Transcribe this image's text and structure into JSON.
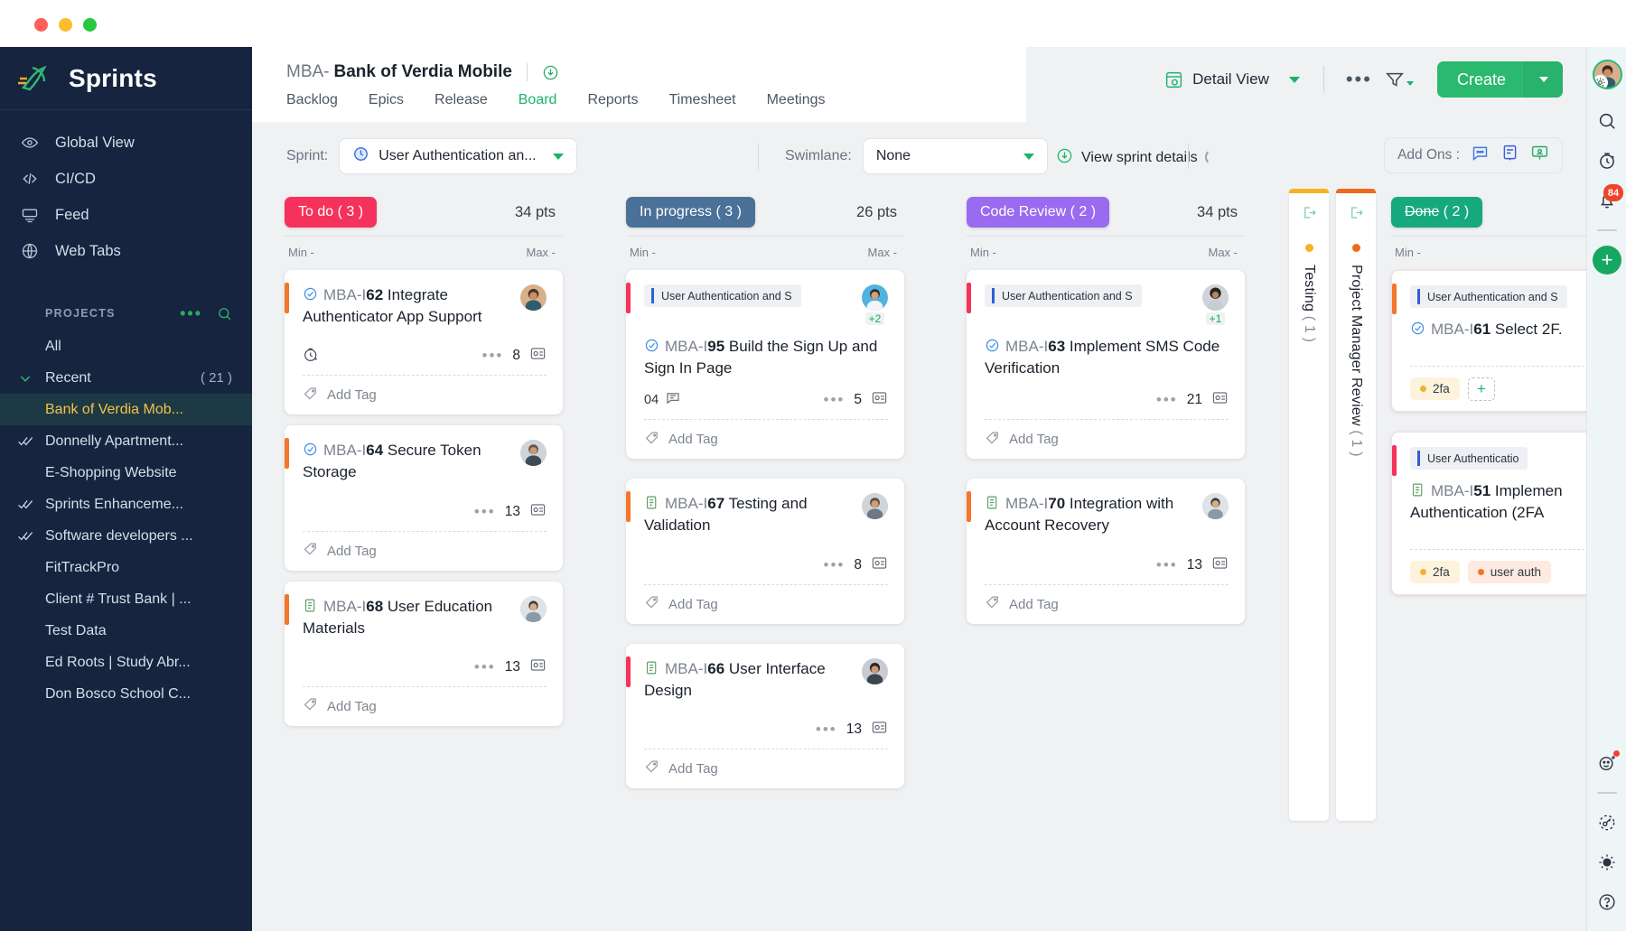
{
  "window": {
    "traffic_lights": [
      "close",
      "minimize",
      "maximize"
    ]
  },
  "sidebar": {
    "brand": "Sprints",
    "nav": [
      {
        "label": "Global View",
        "icon": "eye-icon"
      },
      {
        "label": "CI/CD",
        "icon": "code-icon"
      },
      {
        "label": "Feed",
        "icon": "feed-icon"
      },
      {
        "label": "Web Tabs",
        "icon": "globe-icon"
      }
    ],
    "projects_header": "PROJECTS",
    "projects": [
      {
        "label": "All",
        "icon": "",
        "count": "",
        "active": false
      },
      {
        "label": "Recent",
        "icon": "chevron-down-icon",
        "count": "( 21 )",
        "active": false
      },
      {
        "label": "Bank of Verdia Mob...",
        "icon": "",
        "count": "",
        "active": true
      },
      {
        "label": "Donnelly Apartment...",
        "icon": "double-check-icon",
        "count": "",
        "active": false
      },
      {
        "label": "E-Shopping Website",
        "icon": "",
        "count": "",
        "active": false
      },
      {
        "label": "Sprints Enhanceme...",
        "icon": "double-check-icon",
        "count": "",
        "active": false
      },
      {
        "label": "Software developers ...",
        "icon": "double-check-icon",
        "count": "",
        "active": false
      },
      {
        "label": "FitTrackPro",
        "icon": "",
        "count": "",
        "active": false
      },
      {
        "label": "Client # Trust Bank | ...",
        "icon": "",
        "count": "",
        "active": false
      },
      {
        "label": "Test Data",
        "icon": "",
        "count": "",
        "active": false
      },
      {
        "label": "Ed Roots | Study Abr...",
        "icon": "",
        "count": "",
        "active": false
      },
      {
        "label": "Don Bosco School C...",
        "icon": "",
        "count": "",
        "active": false
      }
    ]
  },
  "header": {
    "project_key": "MBA-",
    "project_name": "Bank of Verdia Mobile",
    "tabs": [
      {
        "label": "Backlog",
        "active": false
      },
      {
        "label": "Epics",
        "active": false
      },
      {
        "label": "Release",
        "active": false
      },
      {
        "label": "Board",
        "active": true
      },
      {
        "label": "Reports",
        "active": false
      },
      {
        "label": "Timesheet",
        "active": false
      },
      {
        "label": "Meetings",
        "active": false
      }
    ],
    "detail_view_label": "Detail View",
    "more_label": "•••",
    "create_label": "Create"
  },
  "filterbar": {
    "sprint_label": "Sprint:",
    "sprint_value": "User Authentication an...",
    "swimlane_label": "Swimlane:",
    "swimlane_value": "None",
    "view_sprint_details": "View sprint details",
    "addons_label": "Add Ons :"
  },
  "board": {
    "min_label": "Min -",
    "max_label": "Max -",
    "add_tag_label": "Add Tag",
    "columns": [
      {
        "name": "To do",
        "count": "( 3 )",
        "chip_color": "#f5325b",
        "points": "34 pts",
        "cards": [
          {
            "strip_color": "#f4762a",
            "epic": "",
            "icon": "task-check-icon",
            "key": "MBA-I",
            "id": "62",
            "title": "Integrate Authenticator App Support",
            "timer": true,
            "comments": "",
            "points": "8",
            "extra_avatars": "",
            "tags": [],
            "footer": "Add Tag"
          },
          {
            "strip_color": "#f4762a",
            "epic": "",
            "icon": "task-check-icon",
            "key": "MBA-I",
            "id": "64",
            "title": "Secure Token Storage",
            "timer": false,
            "comments": "",
            "points": "13",
            "extra_avatars": "",
            "tags": [],
            "footer": "Add Tag"
          },
          {
            "strip_color": "#f4762a",
            "epic": "",
            "icon": "story-icon",
            "key": "MBA-I",
            "id": "68",
            "title": "User Education Materials",
            "timer": false,
            "comments": "",
            "points": "13",
            "extra_avatars": "",
            "tags": [],
            "footer": "Add Tag"
          }
        ]
      },
      {
        "name": "In progress",
        "count": "( 3 )",
        "chip_color": "#4a7198",
        "points": "26 pts",
        "cards": [
          {
            "strip_color": "#f5325b",
            "epic": "User Authentication and S",
            "icon": "task-check-icon",
            "key": "MBA-I",
            "id": "95",
            "title": "Build the Sign Up and Sign In Page",
            "timer": false,
            "comments": "04",
            "points": "5",
            "extra_avatars": "+2",
            "tags": [],
            "footer": "Add Tag"
          },
          {
            "strip_color": "#f4762a",
            "epic": "",
            "icon": "story-icon",
            "key": "MBA-I",
            "id": "67",
            "title": "Testing and Validation",
            "timer": false,
            "comments": "",
            "points": "8",
            "extra_avatars": "",
            "tags": [],
            "footer": "Add Tag"
          },
          {
            "strip_color": "#f5325b",
            "epic": "",
            "icon": "story-icon",
            "key": "MBA-I",
            "id": "66",
            "title": "User Interface Design",
            "timer": false,
            "comments": "",
            "points": "13",
            "extra_avatars": "",
            "tags": [],
            "footer": "Add Tag"
          }
        ]
      },
      {
        "name": "Code Review",
        "count": "( 2 )",
        "chip_color": "#9a6bf0",
        "points": "34 pts",
        "cards": [
          {
            "strip_color": "#f5325b",
            "epic": "User Authentication and S",
            "icon": "task-check-icon",
            "key": "MBA-I",
            "id": "63",
            "title": "Implement SMS Code Verification",
            "timer": false,
            "comments": "",
            "points": "21",
            "extra_avatars": "+1",
            "tags": [],
            "footer": "Add Tag"
          },
          {
            "strip_color": "#f4762a",
            "epic": "",
            "icon": "story-icon",
            "key": "MBA-I",
            "id": "70",
            "title": "Integration with Account Recovery",
            "timer": false,
            "comments": "",
            "points": "13",
            "extra_avatars": "",
            "tags": [],
            "footer": "Add Tag"
          }
        ]
      },
      {
        "name": "Done",
        "count": "( 2 )",
        "chip_color": "#16a97e",
        "points": "",
        "strikethrough": true,
        "cards": [
          {
            "strip_color": "#f4762a",
            "epic": "User Authentication and S",
            "icon": "task-check-icon",
            "key": "MBA-I",
            "id": "61",
            "title": "Select 2F.",
            "timer": false,
            "comments": "",
            "points": "",
            "extra_avatars": "",
            "tags": [
              {
                "label": "2fa",
                "dot": "#f0b429",
                "bg": "#fdf3dd"
              }
            ],
            "footer": ""
          },
          {
            "strip_color": "#f5325b",
            "epic": "User Authenticatio",
            "icon": "story-icon",
            "key": "MBA-I",
            "id": "51",
            "title": "Implemen Authentication (2FA",
            "timer": false,
            "comments": "",
            "points": "",
            "extra_avatars": "",
            "tags": [
              {
                "label": "2fa",
                "dot": "#f0b429",
                "bg": "#fdf3dd"
              },
              {
                "label": "user auth",
                "dot": "#f4762a",
                "bg": "#fdeae0"
              }
            ],
            "footer": ""
          }
        ]
      }
    ],
    "collapsed_columns": [
      {
        "name": "Testing",
        "count": "( 1 )",
        "dot": "#f5b324",
        "top": "#f5b324"
      },
      {
        "name": "Project Manager Review",
        "count": "( 1 )",
        "dot": "#ee6a1c",
        "top": "#ee6a1c"
      }
    ]
  },
  "rail": {
    "notification_count": "84",
    "icons": [
      {
        "name": "search-icon"
      },
      {
        "name": "timer-icon"
      },
      {
        "name": "bell-icon"
      },
      {
        "name": "add-icon"
      },
      {
        "name": "smiley-plus-icon"
      },
      {
        "name": "key-icon"
      },
      {
        "name": "sun-icon"
      },
      {
        "name": "help-icon"
      }
    ]
  },
  "colors": {
    "accent_green": "#19b36b",
    "sidebar_bg": "#16243f",
    "board_bg": "#f0f1f3",
    "danger_red": "#f0432a"
  }
}
